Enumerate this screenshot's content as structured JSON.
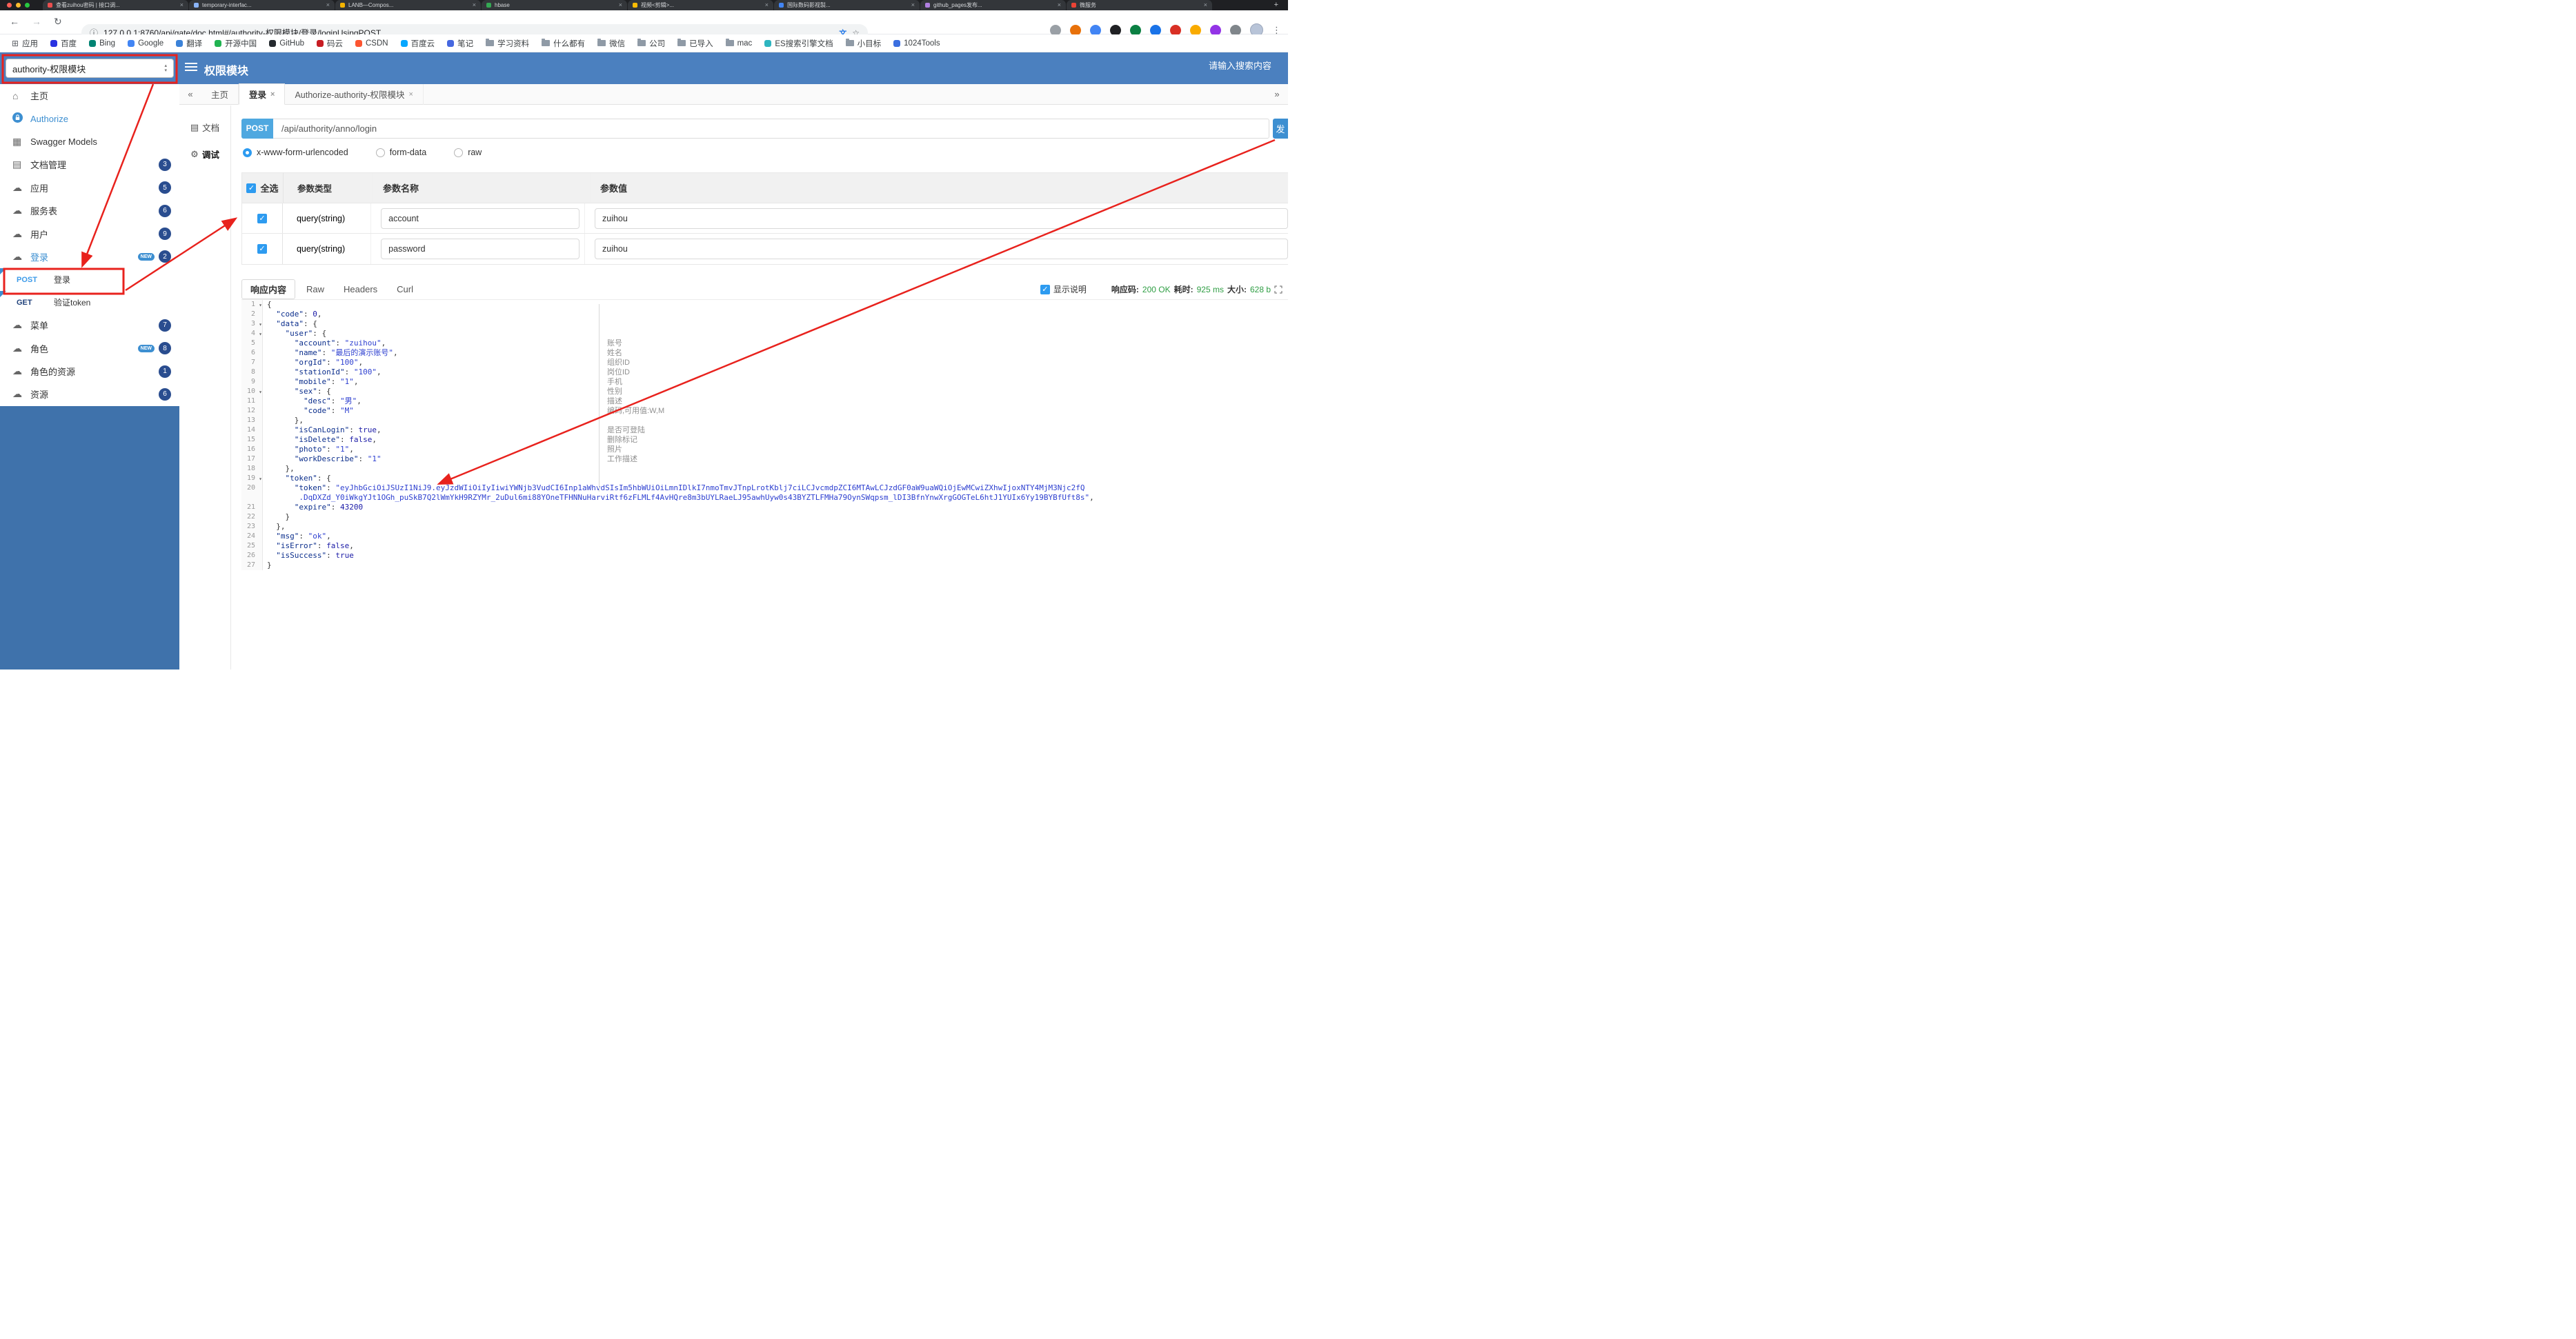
{
  "accent": {
    "header_blue": "#4b80bf",
    "sidebar_blue": "#3f72ab",
    "link_blue": "#3d8fd1",
    "post_badge_blue": "#4fa8e0",
    "badge_navy": "#2a4d8f",
    "annotation_red": "#e8221d",
    "value_green": "#2f9e44"
  },
  "icons": {
    "back": "←",
    "forward": "→",
    "reload": "↻",
    "info": "ⓘ",
    "star": "☆",
    "translate": "文",
    "menu_dots": "⋮",
    "collapse_left": "«",
    "expand_right": "»",
    "check": "✓",
    "fold": "▾",
    "close": "×",
    "apps_grid": "⊞",
    "home": "⌂",
    "models": "▦",
    "doc": "▤",
    "cloud": "☁",
    "debug": "⚙",
    "plus": "+"
  },
  "browser": {
    "window_control_colors": [
      "#ff5f57",
      "#febc2e",
      "#28c840"
    ],
    "tabs": [
      {
        "title": "查看zuihou密码 | 接口调...",
        "favicon_color": "#e94f4f"
      },
      {
        "title": "temporary-interfac...",
        "favicon_color": "#8ab4f8"
      },
      {
        "title": "LANB—Compos...",
        "favicon_color": "#f4b400"
      },
      {
        "title": "hbase",
        "favicon_color": "#34a853"
      },
      {
        "title": "视频<剪辑>...",
        "favicon_color": "#fbbc05"
      },
      {
        "title": "国际数码影视製...",
        "favicon_color": "#4285f4"
      },
      {
        "title": "github_pages发布...",
        "favicon_color": "#b07fe0"
      },
      {
        "title": "微服务",
        "favicon_color": "#ea4335"
      }
    ],
    "url": "127.0.0.1:8760/api/gate/doc.html#/authority-权限模块/登录/loginUsingPOST",
    "ext_icon_colors": [
      "#9aa0a6",
      "#e8710a",
      "#4285f4",
      "#202124",
      "#0b8043",
      "#1a73e8",
      "#d93025",
      "#f9ab00",
      "#9334e6",
      "#80868b"
    ],
    "bookmarks": [
      {
        "label": "应用",
        "kind": "apps"
      },
      {
        "label": "百度",
        "kind": "site",
        "color": "#2932e1"
      },
      {
        "label": "Bing",
        "kind": "site",
        "color": "#008373"
      },
      {
        "label": "Google",
        "kind": "site",
        "color": "#4285f4"
      },
      {
        "label": "翻译",
        "kind": "site",
        "color": "#3b82d8"
      },
      {
        "label": "开源中国",
        "kind": "site",
        "color": "#21b351"
      },
      {
        "label": "GitHub",
        "kind": "site",
        "color": "#24292e"
      },
      {
        "label": "码云",
        "kind": "site",
        "color": "#c71d23"
      },
      {
        "label": "CSDN",
        "kind": "site",
        "color": "#fc5531"
      },
      {
        "label": "百度云",
        "kind": "site",
        "color": "#06a7ff"
      },
      {
        "label": "笔记",
        "kind": "site",
        "color": "#4668e0"
      },
      {
        "label": "学习资料",
        "kind": "folder"
      },
      {
        "label": "什么都有",
        "kind": "folder"
      },
      {
        "label": "微信",
        "kind": "folder"
      },
      {
        "label": "公司",
        "kind": "folder"
      },
      {
        "label": "已导入",
        "kind": "folder"
      },
      {
        "label": "mac",
        "kind": "folder"
      },
      {
        "label": "ES搜索引擎文档",
        "kind": "site",
        "color": "#2eb5c0"
      },
      {
        "label": "小目标",
        "kind": "folder"
      },
      {
        "label": "1024Tools",
        "kind": "site",
        "color": "#3b6fe0"
      }
    ]
  },
  "header": {
    "module_select_value": "authority-权限模块",
    "title": "权限模块",
    "search_placeholder": "请输入搜索内容"
  },
  "sidebar": {
    "new_badge_label": "NEW",
    "items": [
      {
        "label": "主页",
        "icon": "home"
      },
      {
        "label": "Authorize",
        "icon": "lock",
        "active": true
      },
      {
        "label": "Swagger Models",
        "icon": "models"
      },
      {
        "label": "文档管理",
        "icon": "doc",
        "badge": "3"
      },
      {
        "label": "应用",
        "icon": "cloud",
        "badge": "5"
      },
      {
        "label": "服务表",
        "icon": "cloud",
        "badge": "6"
      },
      {
        "label": "用户",
        "icon": "cloud",
        "badge": "9"
      },
      {
        "label": "登录",
        "icon": "cloud",
        "badge": "2",
        "new": true,
        "active": true,
        "children": [
          {
            "method": "POST",
            "label": "登录",
            "highlight": true
          },
          {
            "method": "GET",
            "label": "验证token"
          }
        ]
      },
      {
        "label": "菜单",
        "icon": "cloud",
        "badge": "7"
      },
      {
        "label": "角色",
        "icon": "cloud",
        "badge": "8",
        "new": true
      },
      {
        "label": "角色的资源",
        "icon": "cloud",
        "badge": "1"
      },
      {
        "label": "资源",
        "icon": "cloud",
        "badge": "6"
      }
    ]
  },
  "content": {
    "tabs": [
      {
        "label": "主页",
        "closable": false
      },
      {
        "label": "登录",
        "closable": true,
        "active": true
      },
      {
        "label": "Authorize-authority-权限模块",
        "closable": true
      }
    ],
    "doc_nav": [
      {
        "label": "文档",
        "icon": "doc"
      },
      {
        "label": "调试",
        "icon": "debug",
        "active": true
      }
    ],
    "request": {
      "method": "POST",
      "path": "/api/authority/anno/login",
      "send_label": "发",
      "body_types": [
        {
          "label": "x-www-form-urlencoded",
          "selected": true
        },
        {
          "label": "form-data",
          "selected": false
        },
        {
          "label": "raw",
          "selected": false
        }
      ]
    },
    "params_table": {
      "headers": [
        "全选",
        "参数类型",
        "参数名称",
        "参数值"
      ],
      "rows": [
        {
          "checked": true,
          "type": "query(string)",
          "name": "account",
          "value": "zuihou"
        },
        {
          "checked": true,
          "type": "query(string)",
          "name": "password",
          "value": "zuihou"
        }
      ]
    },
    "response": {
      "tabs": [
        {
          "label": "响应内容",
          "active": true
        },
        {
          "label": "Raw"
        },
        {
          "label": "Headers"
        },
        {
          "label": "Curl"
        }
      ],
      "show_desc_label": "显示说明",
      "show_desc_checked": true,
      "meta": {
        "code_label": "响应码:",
        "code_value": "200 OK",
        "time_label": "耗时:",
        "time_value": "925 ms",
        "size_label": "大小:",
        "size_value": "628 b"
      }
    },
    "code": {
      "lines": [
        {
          "n": "1",
          "fold": true,
          "seg": [
            [
              "p",
              "{"
            ]
          ]
        },
        {
          "n": "2",
          "seg": [
            [
              "p",
              "  "
            ],
            [
              "k",
              "\"code\""
            ],
            [
              "p",
              ": "
            ],
            [
              "n",
              "0"
            ],
            [
              "p",
              ","
            ]
          ]
        },
        {
          "n": "3",
          "fold": true,
          "seg": [
            [
              "p",
              "  "
            ],
            [
              "k",
              "\"data\""
            ],
            [
              "p",
              ": {"
            ]
          ]
        },
        {
          "n": "4",
          "fold": true,
          "seg": [
            [
              "p",
              "    "
            ],
            [
              "k",
              "\"user\""
            ],
            [
              "p",
              ": {"
            ]
          ]
        },
        {
          "n": "5",
          "seg": [
            [
              "p",
              "      "
            ],
            [
              "k",
              "\"account\""
            ],
            [
              "p",
              ": "
            ],
            [
              "s",
              "\"zuihou\""
            ],
            [
              "p",
              ","
            ]
          ],
          "ann": "账号"
        },
        {
          "n": "6",
          "seg": [
            [
              "p",
              "      "
            ],
            [
              "k",
              "\"name\""
            ],
            [
              "p",
              ": "
            ],
            [
              "s",
              "\"最后的演示账号\""
            ],
            [
              "p",
              ","
            ]
          ],
          "ann": "姓名"
        },
        {
          "n": "7",
          "seg": [
            [
              "p",
              "      "
            ],
            [
              "k",
              "\"orgId\""
            ],
            [
              "p",
              ": "
            ],
            [
              "s",
              "\"100\""
            ],
            [
              "p",
              ","
            ]
          ],
          "ann": "组织ID"
        },
        {
          "n": "8",
          "seg": [
            [
              "p",
              "      "
            ],
            [
              "k",
              "\"stationId\""
            ],
            [
              "p",
              ": "
            ],
            [
              "s",
              "\"100\""
            ],
            [
              "p",
              ","
            ]
          ],
          "ann": "岗位ID"
        },
        {
          "n": "9",
          "seg": [
            [
              "p",
              "      "
            ],
            [
              "k",
              "\"mobile\""
            ],
            [
              "p",
              ": "
            ],
            [
              "s",
              "\"1\""
            ],
            [
              "p",
              ","
            ]
          ],
          "ann": "手机"
        },
        {
          "n": "10",
          "fold": true,
          "seg": [
            [
              "p",
              "      "
            ],
            [
              "k",
              "\"sex\""
            ],
            [
              "p",
              ": {"
            ]
          ],
          "ann": "性别"
        },
        {
          "n": "11",
          "seg": [
            [
              "p",
              "        "
            ],
            [
              "k",
              "\"desc\""
            ],
            [
              "p",
              ": "
            ],
            [
              "s",
              "\"男\""
            ],
            [
              "p",
              ","
            ]
          ],
          "ann": "描述"
        },
        {
          "n": "12",
          "seg": [
            [
              "p",
              "        "
            ],
            [
              "k",
              "\"code\""
            ],
            [
              "p",
              ": "
            ],
            [
              "s",
              "\"M\""
            ]
          ],
          "ann": "编码,可用值:W,M"
        },
        {
          "n": "13",
          "seg": [
            [
              "p",
              "      },"
            ]
          ]
        },
        {
          "n": "14",
          "seg": [
            [
              "p",
              "      "
            ],
            [
              "k",
              "\"isCanLogin\""
            ],
            [
              "p",
              ": "
            ],
            [
              "b",
              "true"
            ],
            [
              "p",
              ","
            ]
          ],
          "ann": "是否可登陆"
        },
        {
          "n": "15",
          "seg": [
            [
              "p",
              "      "
            ],
            [
              "k",
              "\"isDelete\""
            ],
            [
              "p",
              ": "
            ],
            [
              "b",
              "false"
            ],
            [
              "p",
              ","
            ]
          ],
          "ann": "删除标记"
        },
        {
          "n": "16",
          "seg": [
            [
              "p",
              "      "
            ],
            [
              "k",
              "\"photo\""
            ],
            [
              "p",
              ": "
            ],
            [
              "s",
              "\"1\""
            ],
            [
              "p",
              ","
            ]
          ],
          "ann": "照片"
        },
        {
          "n": "17",
          "seg": [
            [
              "p",
              "      "
            ],
            [
              "k",
              "\"workDescribe\""
            ],
            [
              "p",
              ": "
            ],
            [
              "s",
              "\"1\""
            ]
          ],
          "ann": "工作描述"
        },
        {
          "n": "18",
          "seg": [
            [
              "p",
              "    },"
            ]
          ]
        },
        {
          "n": "19",
          "fold": true,
          "seg": [
            [
              "p",
              "    "
            ],
            [
              "k",
              "\"token\""
            ],
            [
              "p",
              ": {"
            ]
          ]
        },
        {
          "n": "20",
          "seg": [
            [
              "p",
              "      "
            ],
            [
              "k",
              "\"token\""
            ],
            [
              "p",
              ": "
            ],
            [
              "s",
              "\"eyJhbGciOiJSUzI1NiJ9.eyJzdWIiOiIyIiwiYWNjb3VudCI6Inp1aWhvdSIsIm5hbWUiOiLmnIDlkI7nmoTmvJTnpLrotKblj7ciLCJvcmdpZCI6MTAwLCJzdGF0aW9uaWQiOjEwMCwiZXhwIjoxNTY4MjM3Njc2fQ"
            ]
          ]
        },
        {
          "n": "",
          "seg": [
            [
              "p",
              "       "
            ],
            [
              "s",
              ".DqDXZd_Y0iWkgYJt1OGh_puSkB7Q2lWmYkH9RZYMr_2uDul6mi88YOneTFHNNuHarviRtf6zFLMLf4AvHQre8m3bUYLRaeLJ95awhUyw0s43BYZTLFMHa79OynSWqpsm_lDI3BfnYnwXrgGOGTeL6htJ1YUIx6Yy19BYBfUft8s\""
            ],
            [
              "p",
              ","
            ]
          ]
        },
        {
          "n": "21",
          "seg": [
            [
              "p",
              "      "
            ],
            [
              "k",
              "\"expire\""
            ],
            [
              "p",
              ": "
            ],
            [
              "n",
              "43200"
            ]
          ]
        },
        {
          "n": "22",
          "seg": [
            [
              "p",
              "    }"
            ]
          ]
        },
        {
          "n": "23",
          "seg": [
            [
              "p",
              "  },"
            ]
          ]
        },
        {
          "n": "24",
          "seg": [
            [
              "p",
              "  "
            ],
            [
              "k",
              "\"msg\""
            ],
            [
              "p",
              ": "
            ],
            [
              "s",
              "\"ok\""
            ],
            [
              "p",
              ","
            ]
          ]
        },
        {
          "n": "25",
          "seg": [
            [
              "p",
              "  "
            ],
            [
              "k",
              "\"isError\""
            ],
            [
              "p",
              ": "
            ],
            [
              "b",
              "false"
            ],
            [
              "p",
              ","
            ]
          ]
        },
        {
          "n": "26",
          "seg": [
            [
              "p",
              "  "
            ],
            [
              "k",
              "\"isSuccess\""
            ],
            [
              "p",
              ": "
            ],
            [
              "b",
              "true"
            ]
          ]
        },
        {
          "n": "27",
          "seg": [
            [
              "p",
              "}"
            ]
          ]
        }
      ]
    }
  }
}
